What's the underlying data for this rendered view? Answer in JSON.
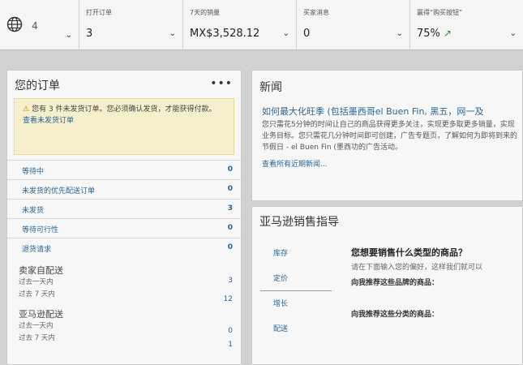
{
  "metrics": {
    "globe_count": "4",
    "open_orders": {
      "label": "打开订单",
      "value": "3"
    },
    "sales_7d": {
      "label": "7天的销量",
      "value": "MX$3,528.12"
    },
    "buyer_messages": {
      "label": "买家消息",
      "value": "0"
    },
    "rating": {
      "label": "赢得“购买按钮”",
      "value": "75%"
    }
  },
  "orders": {
    "title": "您的订单",
    "alert_text": "您有 3 件未发货订单。您必须确认发货，才能获得付款。",
    "alert_link": "查看未发货订单",
    "rows": [
      {
        "label": "等待中",
        "count": "0"
      },
      {
        "label": "未发货的优先配送订单",
        "count": "0"
      },
      {
        "label": "未发货",
        "count": "3"
      },
      {
        "label": "等待可行性",
        "count": "0"
      },
      {
        "label": "退货请求",
        "count": "0"
      }
    ],
    "seller_fulfilled": {
      "title": "卖家自配送",
      "day_label": "过去一天内",
      "day_count": "3",
      "week_label": "过去 7 天内",
      "week_count": "12"
    },
    "amazon_fulfilled": {
      "title": "亚马逊配送",
      "day_label": "过去一天内",
      "day_count": "0",
      "week_label": "过去 7 天内",
      "week_count": "1"
    }
  },
  "news": {
    "title": "新闻",
    "headline": "如何最大化旺季 (包括墨西哥el Buen Fin, 黑五，网一及",
    "body": "您只需花5分钟的时间让自己的商品获得更多关注，实现更多取更多销量，实现业务目标。您只需花几分钟时间即可创建，广告专题页，了解如何为即将到来的节假日 - el Buen Fin (墨西功的广告活动。",
    "link": "查看所有近期新闻..."
  },
  "guide": {
    "title": "亚马逊销售指导",
    "tabs": [
      "库存",
      "定价",
      "增长",
      "配送"
    ],
    "question_title": "您想要销售什么类型的商品？",
    "question_sub": "请在下面输入您的偏好，这样我们就可以",
    "q_brands": "向我推荐这些品牌的商品：",
    "q_categories": "向我推荐这些分类的商品："
  }
}
